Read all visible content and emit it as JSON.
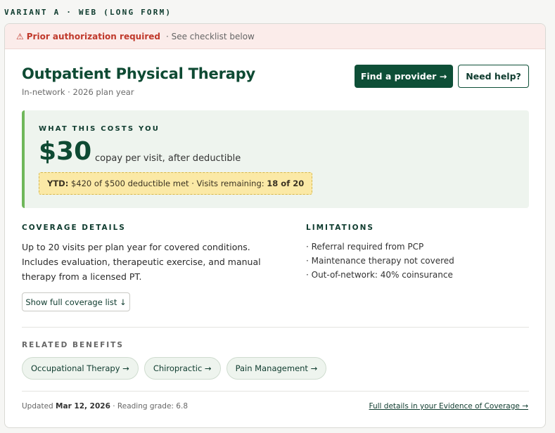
{
  "variant_label": "VARIANT A · WEB (LONG FORM)",
  "alert": {
    "icon": "warning-icon",
    "title": "Prior authorization required",
    "subtitle": "· See checklist below",
    "color": "#c0392b"
  },
  "header": {
    "title": "Outpatient Physical Therapy",
    "subtitle": "In-network · 2026 plan year",
    "primary_button": "Find a provider →",
    "secondary_button": "Need help?"
  },
  "cost": {
    "label": "WHAT THIS COSTS YOU",
    "amount": "$30",
    "note": "copay per visit, after deductible",
    "ytd_label": "YTD:",
    "ytd_text": "$420 of $500 deductible met · Visits remaining:",
    "ytd_visits": "18 of 20"
  },
  "coverage": {
    "heading": "COVERAGE DETAILS",
    "text": "Up to 20 visits per plan year for covered conditions. Includes evaluation, therapeutic exercise, and manual therapy from a licensed PT.",
    "show_button": "Show full coverage list ↓"
  },
  "limitations": {
    "heading": "LIMITATIONS",
    "items": [
      "· Referral required from PCP",
      "· Maintenance therapy not covered",
      "· Out-of-network: 40% coinsurance"
    ]
  },
  "related": {
    "heading": "RELATED BENEFITS",
    "items": [
      "Occupational Therapy →",
      "Chiropractic →",
      "Pain Management →"
    ]
  },
  "footer": {
    "updated_label": "Updated",
    "updated_date": "Mar 12, 2026",
    "reading_grade": "· Reading grade: 6.8",
    "link": "Full details in your Evidence of Coverage →"
  },
  "colors": {
    "brand": "#0e4f37",
    "accent": "#6fb75a",
    "alert_bg": "#fbecea",
    "ytd_bg": "#fbe9a6"
  }
}
